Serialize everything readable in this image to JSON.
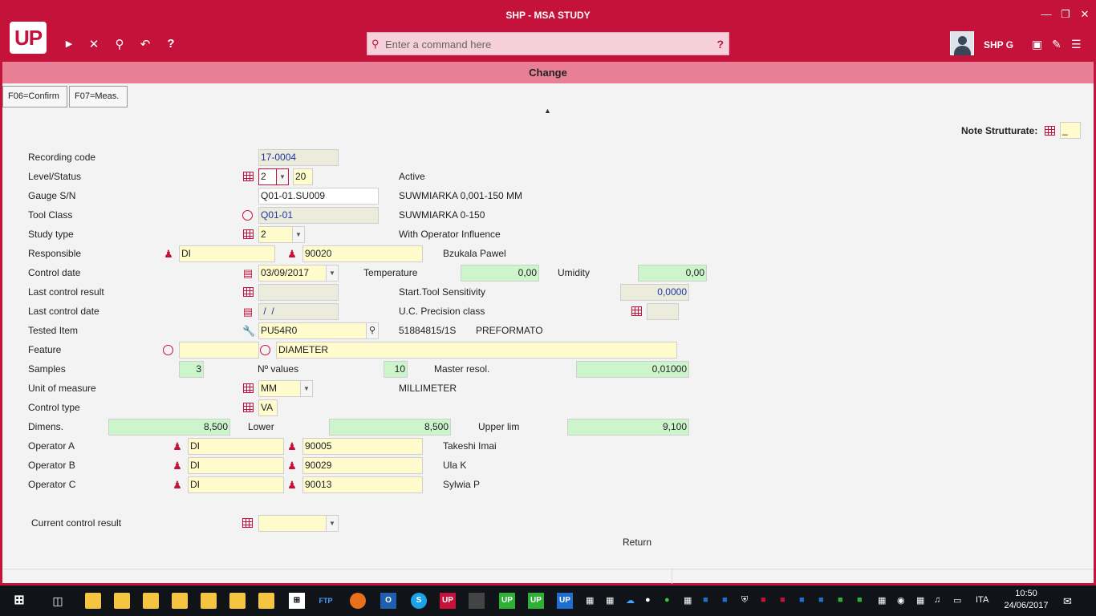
{
  "window": {
    "title": "SHP - MSA STUDY",
    "minimize": "—",
    "restore": "❐",
    "close": "✕"
  },
  "toolbar": {
    "logo": "UP",
    "play": "▶",
    "cancel": "✕",
    "search": "⚲",
    "undo": "↶",
    "help": "?",
    "command_placeholder": "Enter a command here",
    "command_help": "?",
    "user": "SHP G"
  },
  "subheader": {
    "title": "Change"
  },
  "fkeys": {
    "confirm": "F06=Confirm",
    "meas": "F07=Meas."
  },
  "note": {
    "label": "Note Strutturate:",
    "value": "_"
  },
  "form": {
    "recording_code": {
      "label": "Recording code",
      "value": "17-0004"
    },
    "level_status": {
      "label": "Level/Status",
      "level": "2",
      "status": "20",
      "desc": "Active"
    },
    "gauge": {
      "label": "Gauge S/N",
      "value": "Q01-01.SU009",
      "desc": "SUWMIARKA 0,001-150 MM"
    },
    "tool_class": {
      "label": "Tool Class",
      "value": "Q01-01",
      "desc": "SUWMIARKA 0-150"
    },
    "study_type": {
      "label": "Study type",
      "value": "2",
      "desc": "With Operator Influence"
    },
    "responsible": {
      "label": "Responsible",
      "dept": "DI",
      "code": "90020",
      "name": "Bzukala Pawel"
    },
    "control_date": {
      "label": "Control date",
      "value": "03/09/2017"
    },
    "temperature": {
      "label": "Temperature",
      "value": "0,00"
    },
    "umidity": {
      "label": "Umidity",
      "value": "0,00"
    },
    "last_control_result": {
      "label": "Last control result",
      "value": ""
    },
    "start_tool_sensitivity": {
      "label": "Start.Tool Sensitivity",
      "value": "0,0000"
    },
    "last_control_date": {
      "label": "Last control date",
      "value": " /  /"
    },
    "uc_precision": {
      "label": "U.C. Precision class",
      "value": ""
    },
    "tested_item": {
      "label": "Tested Item",
      "value": "PU54R0",
      "code": "51884815/1S",
      "desc": "PREFORMATO"
    },
    "feature": {
      "label": "Feature",
      "value": "",
      "desc": "DIAMETER"
    },
    "samples": {
      "label": "Samples",
      "value": "3"
    },
    "n_values": {
      "label": "Nº values",
      "value": "10"
    },
    "master_resol": {
      "label": "Master resol.",
      "value": "0,01000"
    },
    "uom": {
      "label": "Unit of measure",
      "value": "MM",
      "desc": "MILLIMETER"
    },
    "control_type": {
      "label": "Control type",
      "value": "VA"
    },
    "dimens": {
      "label": "Dimens.",
      "value": "8,500"
    },
    "lower": {
      "label": "Lower",
      "value": "8,500"
    },
    "upper": {
      "label": "Upper lim",
      "value": "9,100"
    },
    "operator_a": {
      "label": "Operator A",
      "dept": "DI",
      "code": "90005",
      "name": "Takeshi Imai"
    },
    "operator_b": {
      "label": "Operator B",
      "dept": "DI",
      "code": "90029",
      "name": "Ula K"
    },
    "operator_c": {
      "label": "Operator C",
      "dept": "DI",
      "code": "90013",
      "name": "Sylwia P"
    },
    "current_control_result": {
      "label": "Current control result",
      "value": ""
    },
    "return": "Return"
  },
  "taskbar": {
    "lang": "ITA",
    "time": "10:50",
    "date": "24/06/2017",
    "ftp": "FTP"
  }
}
